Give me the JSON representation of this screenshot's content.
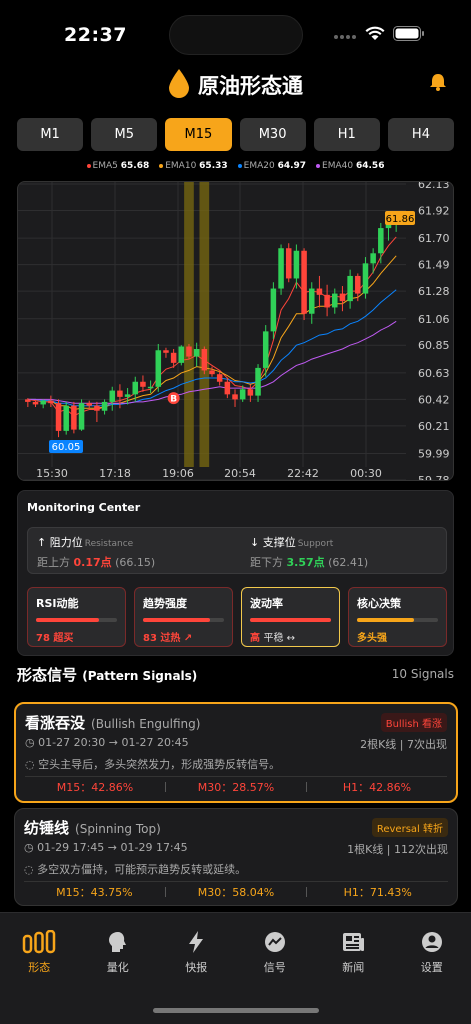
{
  "status": {
    "time": "22:37"
  },
  "header": {
    "title": "原油形态通"
  },
  "timeframes": [
    {
      "label": "M1",
      "active": false
    },
    {
      "label": "M5",
      "active": false
    },
    {
      "label": "M15",
      "active": true
    },
    {
      "label": "M30",
      "active": false
    },
    {
      "label": "H1",
      "active": false
    },
    {
      "label": "H4",
      "active": false
    }
  ],
  "ema": [
    {
      "name": "EMA5",
      "value": "65.68",
      "color": "#ff453a"
    },
    {
      "name": "EMA10",
      "value": "65.33",
      "color": "#f7a51a"
    },
    {
      "name": "EMA20",
      "value": "64.97",
      "color": "#0a84ff"
    },
    {
      "name": "EMA40",
      "value": "64.56",
      "color": "#bf5af2"
    }
  ],
  "chart_data": {
    "type": "candlestick",
    "y_ticks": [
      "62.13",
      "61.92",
      "61.70",
      "61.49",
      "61.28",
      "61.06",
      "60.85",
      "60.63",
      "60.42",
      "60.21",
      "59.99",
      "59.78"
    ],
    "ylim": [
      59.78,
      62.13
    ],
    "x_ticks": [
      "15:30",
      "17:18",
      "19:06",
      "20:54",
      "22:42",
      "00:30"
    ],
    "last_price": "61.86",
    "low_label": "60.05",
    "marker": "B",
    "colors": {
      "up": "#30d158",
      "down": "#ff453a",
      "highlight": "#7a6a10"
    },
    "candles": [
      [
        60.42,
        60.43,
        60.36,
        60.4
      ],
      [
        60.4,
        60.41,
        60.36,
        60.38
      ],
      [
        60.38,
        60.42,
        60.35,
        60.41
      ],
      [
        60.41,
        60.45,
        60.36,
        60.39
      ],
      [
        60.39,
        60.42,
        60.12,
        60.17
      ],
      [
        60.17,
        60.4,
        60.14,
        60.37
      ],
      [
        60.37,
        60.4,
        60.15,
        60.18
      ],
      [
        60.18,
        60.42,
        60.17,
        60.39
      ],
      [
        60.39,
        60.41,
        60.35,
        60.37
      ],
      [
        60.37,
        60.4,
        60.24,
        60.33
      ],
      [
        60.33,
        60.42,
        60.3,
        60.4
      ],
      [
        60.4,
        60.52,
        60.33,
        60.49
      ],
      [
        60.49,
        60.54,
        60.35,
        60.44
      ],
      [
        60.44,
        60.51,
        60.38,
        60.46
      ],
      [
        60.46,
        60.6,
        60.4,
        60.56
      ],
      [
        60.56,
        60.61,
        60.48,
        60.52
      ],
      [
        60.52,
        60.57,
        60.47,
        60.52
      ],
      [
        60.52,
        60.86,
        60.48,
        60.81
      ],
      [
        60.81,
        60.83,
        60.75,
        60.79
      ],
      [
        60.79,
        60.82,
        60.67,
        60.71
      ],
      [
        60.71,
        60.85,
        60.69,
        60.84
      ],
      [
        60.84,
        60.86,
        60.74,
        60.76
      ],
      [
        60.76,
        60.87,
        60.68,
        60.82
      ],
      [
        60.82,
        60.84,
        60.62,
        60.65
      ],
      [
        60.65,
        60.68,
        60.6,
        60.62
      ],
      [
        60.62,
        60.64,
        60.53,
        60.56
      ],
      [
        60.56,
        60.59,
        60.43,
        60.46
      ],
      [
        60.46,
        60.5,
        60.36,
        60.42
      ],
      [
        60.42,
        60.53,
        60.4,
        60.5
      ],
      [
        60.5,
        60.54,
        60.4,
        60.45
      ],
      [
        60.45,
        60.7,
        60.4,
        60.67
      ],
      [
        60.67,
        61.01,
        60.6,
        60.96
      ],
      [
        60.96,
        61.35,
        60.9,
        61.3
      ],
      [
        61.3,
        61.65,
        61.25,
        61.62
      ],
      [
        61.62,
        61.66,
        61.35,
        61.38
      ],
      [
        61.38,
        61.65,
        61.3,
        61.6
      ],
      [
        61.6,
        61.62,
        61.05,
        61.1
      ],
      [
        61.1,
        61.35,
        61.02,
        61.3
      ],
      [
        61.3,
        61.4,
        61.15,
        61.25
      ],
      [
        61.25,
        61.33,
        61.08,
        61.15
      ],
      [
        61.15,
        61.3,
        61.1,
        61.26
      ],
      [
        61.26,
        61.32,
        61.12,
        61.2
      ],
      [
        61.2,
        61.45,
        61.14,
        61.4
      ],
      [
        61.4,
        61.42,
        61.2,
        61.26
      ],
      [
        61.26,
        61.55,
        61.22,
        61.5
      ],
      [
        61.5,
        61.62,
        61.42,
        61.58
      ],
      [
        61.58,
        61.82,
        61.5,
        61.78
      ],
      [
        61.78,
        61.88,
        61.68,
        61.82
      ],
      [
        61.82,
        61.9,
        61.75,
        61.86
      ]
    ],
    "highlight_indices": [
      21,
      23
    ],
    "ema_lines": [
      {
        "color": "#ff453a",
        "values": [
          60.42,
          60.41,
          60.4,
          60.4,
          60.32,
          60.34,
          60.29,
          60.32,
          60.34,
          60.34,
          60.36,
          60.4,
          60.41,
          60.43,
          60.47,
          60.49,
          60.5,
          60.6,
          60.66,
          60.68,
          60.73,
          60.74,
          60.77,
          60.73,
          60.69,
          60.65,
          60.59,
          60.53,
          60.52,
          60.5,
          60.56,
          60.69,
          60.89,
          61.13,
          61.22,
          61.35,
          61.27,
          61.28,
          61.27,
          61.23,
          61.24,
          61.23,
          61.28,
          61.28,
          61.35,
          61.43,
          61.55,
          61.64,
          61.71
        ]
      },
      {
        "color": "#f7a51a",
        "values": [
          60.42,
          60.42,
          60.41,
          60.41,
          60.37,
          60.37,
          60.34,
          60.35,
          60.35,
          60.35,
          60.36,
          60.38,
          60.39,
          60.41,
          60.43,
          60.45,
          60.46,
          60.52,
          60.57,
          60.59,
          60.63,
          60.65,
          60.68,
          60.67,
          60.66,
          60.64,
          60.61,
          60.57,
          60.56,
          60.54,
          60.56,
          60.63,
          60.75,
          60.91,
          61.0,
          61.1,
          61.1,
          61.14,
          61.16,
          61.16,
          61.18,
          61.18,
          61.22,
          61.23,
          61.28,
          61.34,
          61.42,
          61.49,
          61.56
        ]
      },
      {
        "color": "#0a84ff",
        "values": [
          60.42,
          60.42,
          60.41,
          60.41,
          60.39,
          60.39,
          60.37,
          60.37,
          60.37,
          60.37,
          60.37,
          60.38,
          60.38,
          60.39,
          60.4,
          60.42,
          60.43,
          60.46,
          60.49,
          60.51,
          60.54,
          60.56,
          60.58,
          60.59,
          60.59,
          60.59,
          60.58,
          60.56,
          60.56,
          60.55,
          60.56,
          60.59,
          60.65,
          60.73,
          60.78,
          60.85,
          60.87,
          60.9,
          60.93,
          60.94,
          60.97,
          60.98,
          61.02,
          61.04,
          61.08,
          61.13,
          61.19,
          61.24,
          61.29
        ]
      },
      {
        "color": "#bf5af2",
        "values": [
          60.42,
          60.42,
          60.42,
          60.42,
          60.41,
          60.4,
          60.39,
          60.39,
          60.39,
          60.39,
          60.39,
          60.39,
          60.39,
          60.39,
          60.4,
          60.4,
          60.41,
          60.42,
          60.44,
          60.45,
          60.46,
          60.48,
          60.49,
          60.5,
          60.51,
          60.52,
          60.51,
          60.51,
          60.51,
          60.51,
          60.51,
          60.53,
          60.56,
          60.61,
          60.65,
          60.69,
          60.71,
          60.74,
          60.76,
          60.78,
          60.8,
          60.82,
          60.85,
          60.87,
          60.9,
          60.93,
          60.97,
          61.0,
          61.04
        ]
      }
    ]
  },
  "monitor": {
    "title": "Monitoring Center",
    "resistance": {
      "label": "阻力位",
      "en": "Resistance",
      "dist_label": "距上方",
      "dist": "0.17点",
      "level": "(66.15)"
    },
    "support": {
      "label": "支撑位",
      "en": "Support",
      "dist_label": "距下方",
      "dist": "3.57点",
      "level": "(62.41)"
    },
    "cards": [
      {
        "title": "RSI动能",
        "value": "78 超买",
        "fill": 0.78,
        "color": "#ff453a",
        "style": "red"
      },
      {
        "title": "趋势强度",
        "value": "83 过热 ↗",
        "fill": 0.83,
        "color": "#ff453a",
        "style": "red"
      },
      {
        "title": "波动率",
        "value_a": "高",
        "value_b": "平稳 ↔",
        "fill": 1.0,
        "color": "#ff453a",
        "style": "yellow"
      },
      {
        "title": "核心决策",
        "value": "多头强",
        "fill": 0.7,
        "color": "#f7a51a",
        "style": "red"
      }
    ]
  },
  "signals_section": {
    "title": "形态信号",
    "title_en": "(Pattern Signals)",
    "count": "10 Signals"
  },
  "signals": [
    {
      "name": "看涨吞没",
      "name_en": "(Bullish Engulfing)",
      "badge": "Bullish 看涨",
      "badge_style": "badge-red",
      "time": "01-27 20:30 → 01-27 20:45",
      "meta": "2根K线 | 7次出现",
      "desc": "空头主导后，多头突然发力，形成强势反转信号。",
      "stats": [
        "M15：42.86%",
        "M30：28.57%",
        "H1：42.86%"
      ],
      "stat_style": "stat-red",
      "highlight": true
    },
    {
      "name": "纺锤线",
      "name_en": "(Spinning Top)",
      "badge": "Reversal 转折",
      "badge_style": "badge-orange",
      "time": "01-29 17:45 → 01-29 17:45",
      "meta": "1根K线 | 112次出现",
      "desc": "多空双方僵持，可能预示趋势反转或延续。",
      "stats": [
        "M15：43.75%",
        "M30：58.04%",
        "H1：71.43%"
      ],
      "stat_style": "stat-orange",
      "highlight": false
    }
  ],
  "tabs": [
    {
      "label": "形态",
      "icon": "candles-icon",
      "active": true
    },
    {
      "label": "量化",
      "icon": "brain-icon",
      "active": false
    },
    {
      "label": "快报",
      "icon": "lightning-icon",
      "active": false
    },
    {
      "label": "信号",
      "icon": "chart-circle-icon",
      "active": false
    },
    {
      "label": "新闻",
      "icon": "newspaper-icon",
      "active": false
    },
    {
      "label": "设置",
      "icon": "person-icon",
      "active": false
    }
  ]
}
